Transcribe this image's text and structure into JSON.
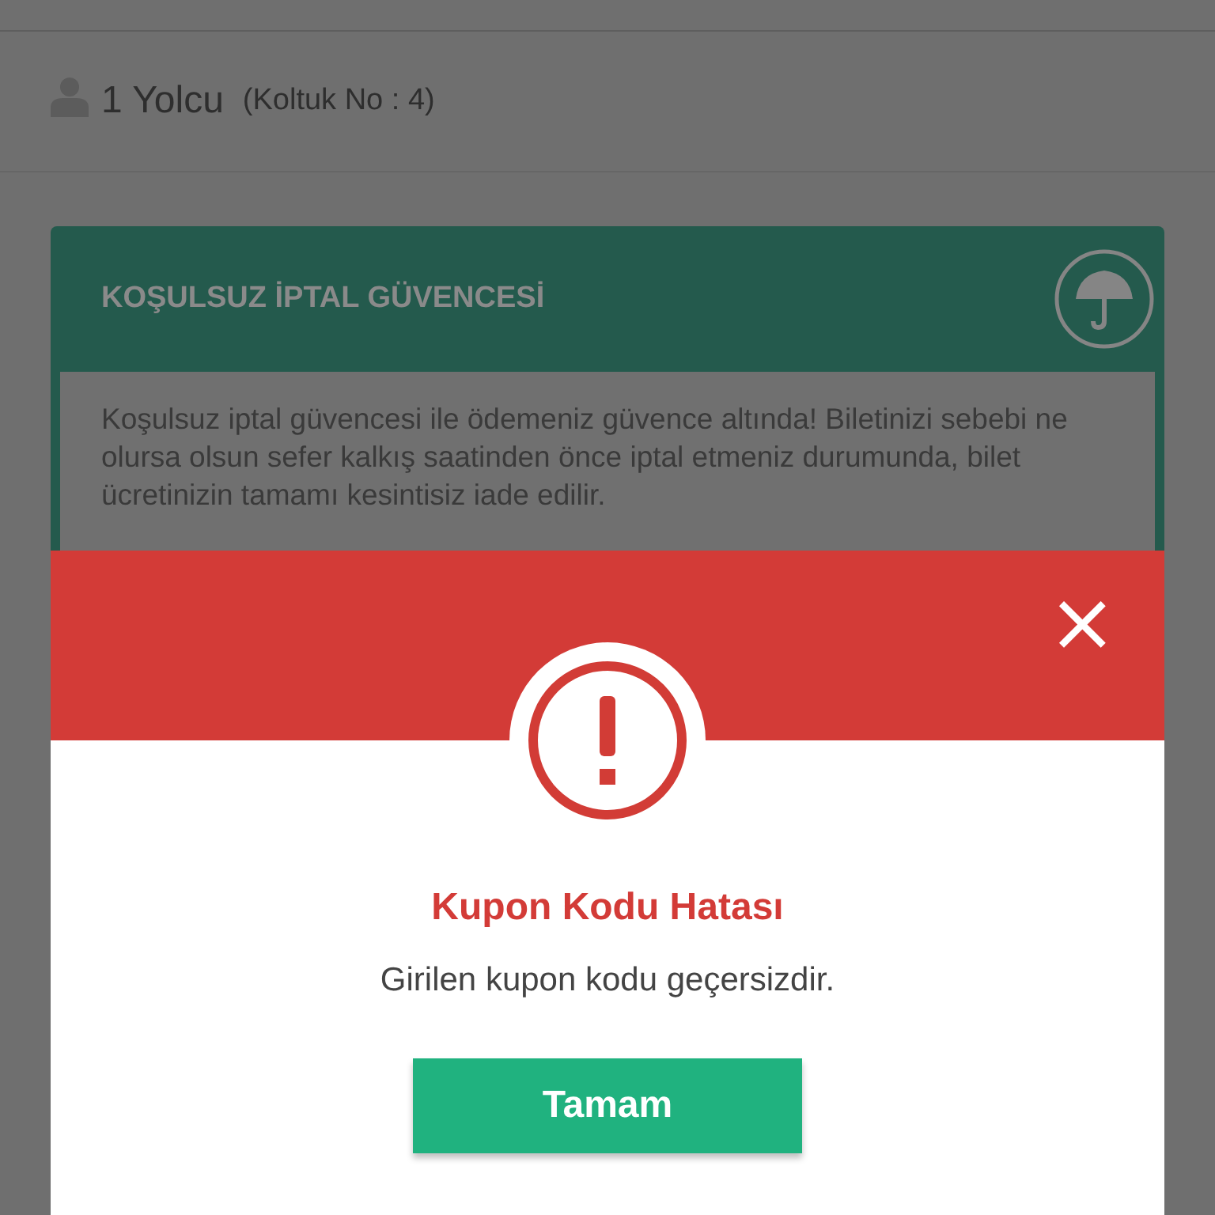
{
  "passenger": {
    "count": "1 Yolcu",
    "seat": "(Koltuk No : 4)"
  },
  "insurance_card": {
    "title": "KOŞULSUZ İPTAL GÜVENCESİ",
    "text": "Koşulsuz iptal güvencesi ile ödemeniz güvence altında! Biletinizi sebebi ne olursa olsun sefer kalkış saatinden önce iptal etmeniz durumunda, bilet ücretinizin tamamı kesintisiz iade edilir."
  },
  "dialog": {
    "close": "×",
    "title": "Kupon Kodu Hatası",
    "message": "Girilen kupon kodu geçersizdir.",
    "button": "Tamam"
  }
}
